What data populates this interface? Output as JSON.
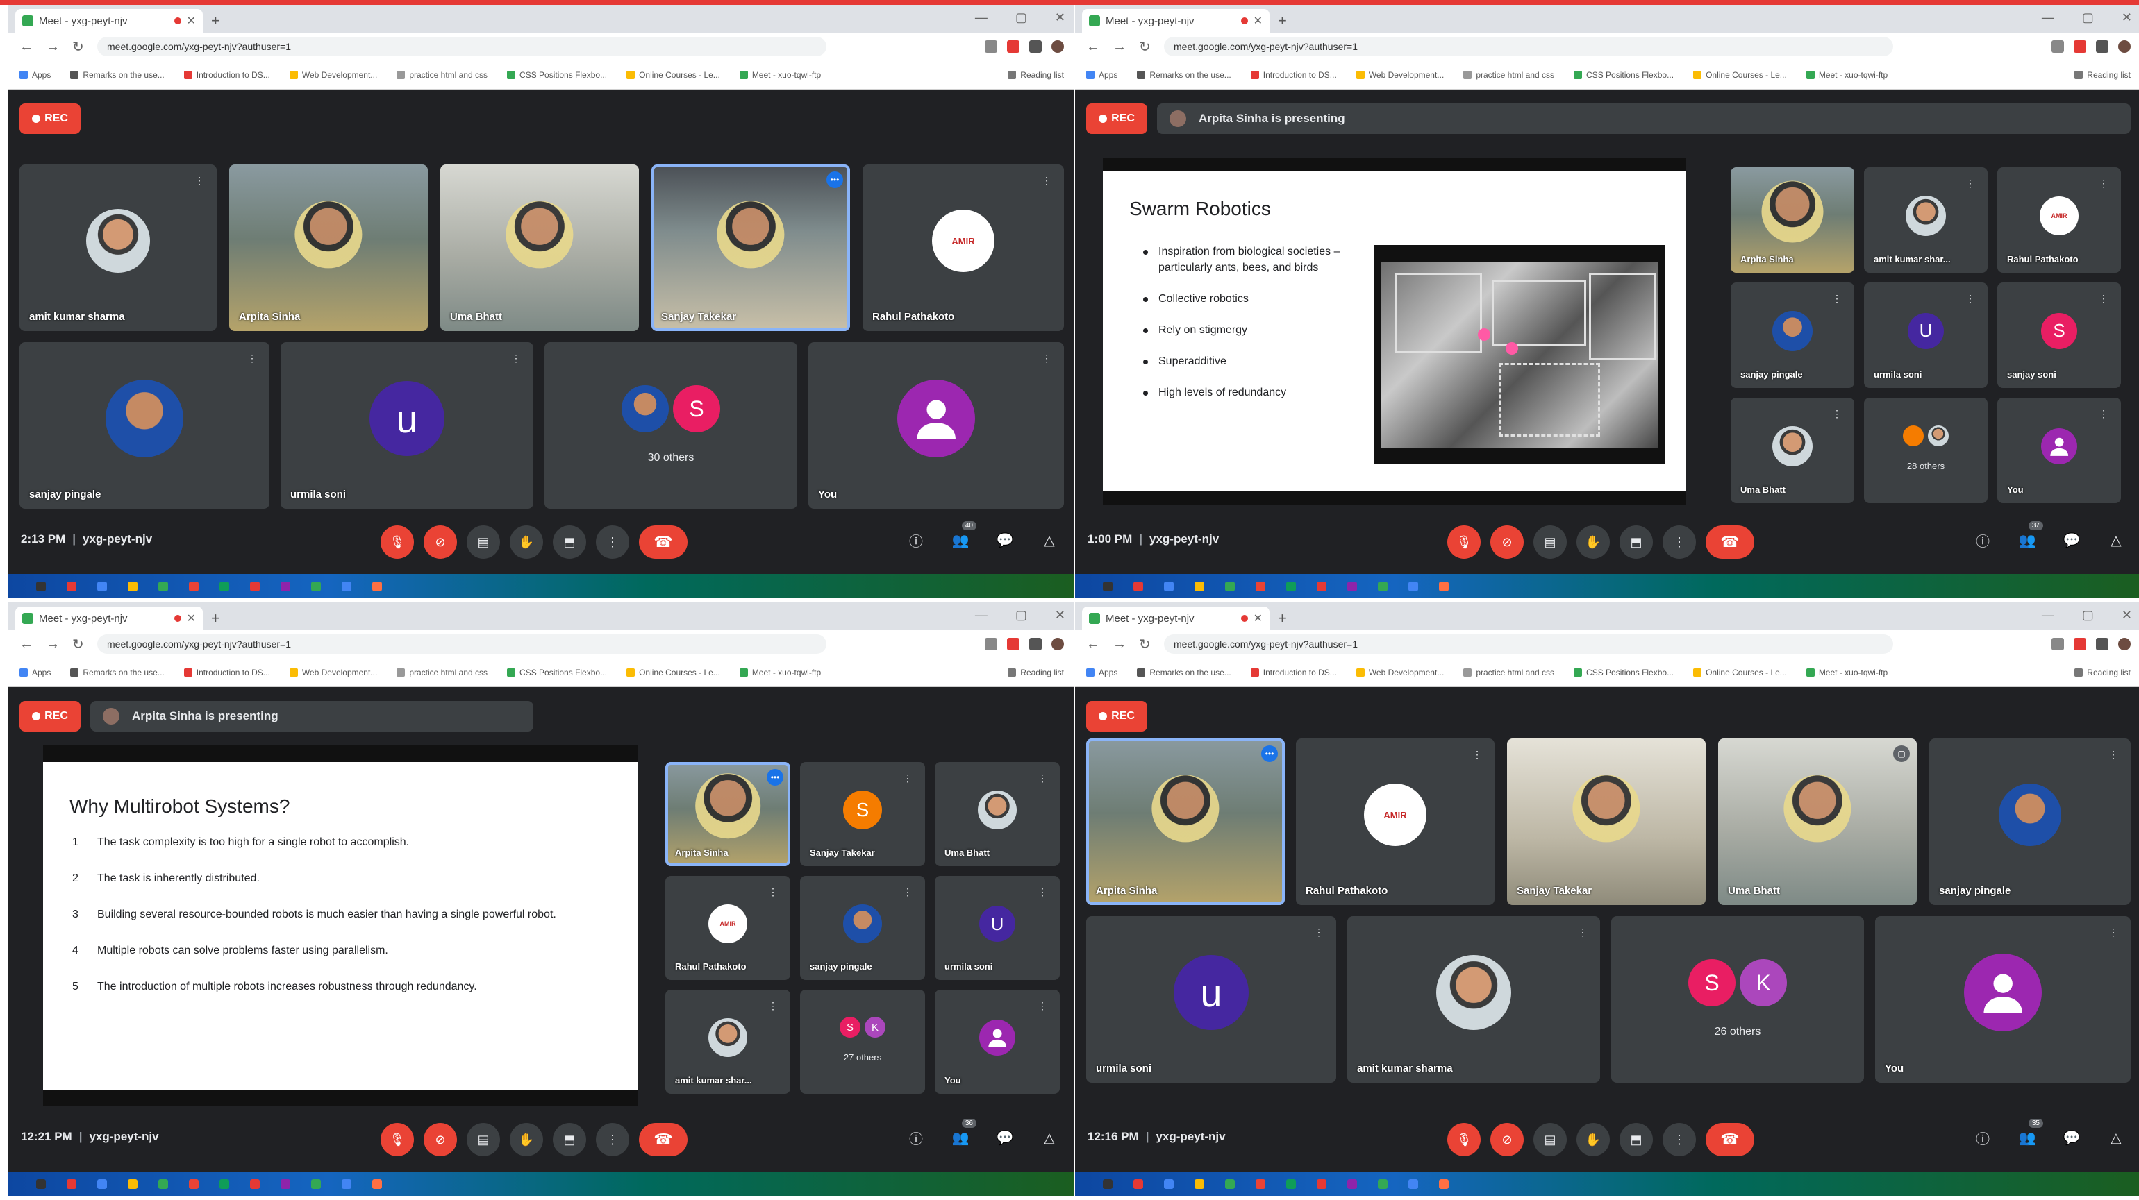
{
  "browser": {
    "tab_title": "Meet - yxg-peyt-njv",
    "url": "meet.google.com/yxg-peyt-njv?authuser=1",
    "bookmarks": [
      "Apps",
      "Remarks on the use...",
      "Introduction to DS...",
      "Web Development...",
      "practice html and css",
      "CSS Positions Flexbo...",
      "Online Courses - Le...",
      "Meet - xuo-tqwi-ftp"
    ],
    "reading_list": "Reading list"
  },
  "meeting": {
    "rec_label": "REC",
    "code": "yxg-peyt-njv",
    "presenting_text": "Arpita Sinha is presenting"
  },
  "quads": [
    {
      "time": "2:13 PM",
      "tiles": [
        {
          "name": "amit kumar sharma"
        },
        {
          "name": "Arpita Sinha"
        },
        {
          "name": "Uma Bhatt"
        },
        {
          "name": "Sanjay Takekar"
        },
        {
          "name": "Rahul Pathakoto"
        },
        {
          "name": "sanjay pingale"
        },
        {
          "name": "urmila soni",
          "letter": "u"
        },
        {
          "name": "",
          "others": "30 others",
          "letter": "S"
        },
        {
          "name": "You"
        }
      ]
    },
    {
      "time": "1:00 PM",
      "slide": {
        "title": "Swarm Robotics",
        "bullets": [
          "Inspiration from biological societies – particularly ants, bees, and birds",
          "Collective robotics",
          "Rely on stigmergy",
          "Superadditive",
          "High levels of redundancy"
        ]
      },
      "tiles": [
        {
          "name": "Arpita Sinha"
        },
        {
          "name": "amit kumar shar..."
        },
        {
          "name": "Rahul Pathakoto"
        },
        {
          "name": "sanjay pingale"
        },
        {
          "name": "urmila soni",
          "letter": "U"
        },
        {
          "name": "sanjay soni",
          "letter": "S"
        },
        {
          "name": "Uma Bhatt"
        },
        {
          "name": "",
          "others": "28 others"
        },
        {
          "name": "You"
        }
      ]
    },
    {
      "time": "12:21 PM",
      "slide": {
        "title": "Why Multirobot Systems?",
        "items": [
          {
            "num": "1",
            "text": "The task complexity is too high for a single robot to accomplish."
          },
          {
            "num": "2",
            "text": "The task is inherently distributed."
          },
          {
            "num": "3",
            "text": "Building several resource-bounded robots is much easier than having a single powerful robot."
          },
          {
            "num": "4",
            "text": "Multiple robots can solve problems faster using parallelism."
          },
          {
            "num": "5",
            "text": "The introduction of multiple robots increases robustness through redundancy."
          }
        ]
      },
      "tiles": [
        {
          "name": "Arpita Sinha"
        },
        {
          "name": "Sanjay Takekar",
          "letter": "S"
        },
        {
          "name": "Uma Bhatt"
        },
        {
          "name": "Rahul Pathakoto"
        },
        {
          "name": "sanjay pingale"
        },
        {
          "name": "urmila soni",
          "letter": "U"
        },
        {
          "name": "amit kumar shar..."
        },
        {
          "name": "",
          "others": "27 others",
          "letters": [
            "S",
            "K"
          ]
        },
        {
          "name": "You"
        }
      ]
    },
    {
      "time": "12:16 PM",
      "tiles": [
        {
          "name": "Arpita Sinha"
        },
        {
          "name": "Rahul Pathakoto"
        },
        {
          "name": "Sanjay Takekar"
        },
        {
          "name": "Uma Bhatt"
        },
        {
          "name": "sanjay pingale"
        },
        {
          "name": "urmila soni",
          "letter": "u"
        },
        {
          "name": "amit kumar sharma"
        },
        {
          "name": "",
          "others": "26 others",
          "letters": [
            "S",
            "K"
          ]
        },
        {
          "name": "You"
        }
      ]
    }
  ],
  "colors": {
    "meet_bg": "#202124",
    "tile_bg": "#3c4043",
    "rec_red": "#ea4335",
    "active_border": "#8ab4f8",
    "avatar_purple": "#4527a0",
    "avatar_pink": "#e91e63",
    "avatar_orange": "#f57c00",
    "you_purple": "#9c27b0"
  },
  "logo_text": "AMIR"
}
